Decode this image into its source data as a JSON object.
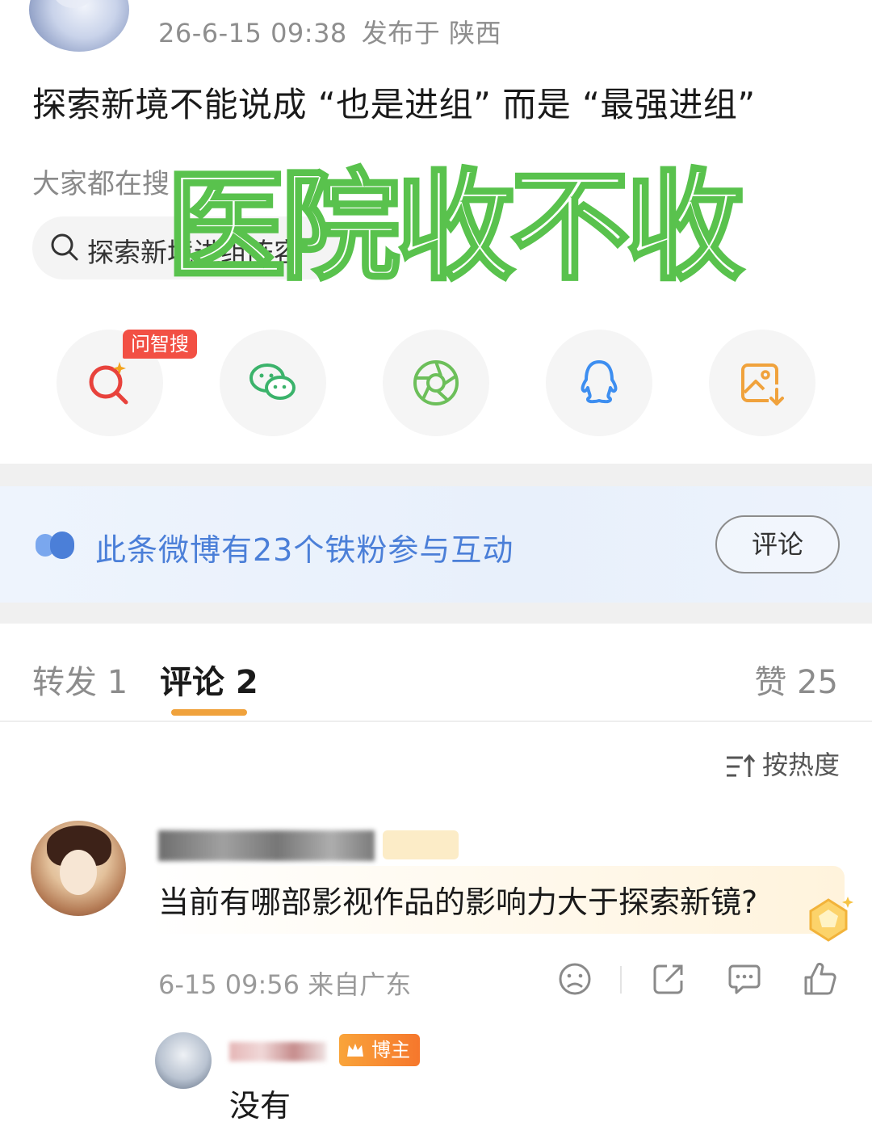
{
  "post": {
    "timestamp": "26-6-15 09:38",
    "location": "发布于 陕西",
    "text": "探索新境不能说成 “也是进组” 而是 “最强进组”"
  },
  "search": {
    "section_title": "大家都在搜",
    "query": "探索新境进组阵容"
  },
  "overlay": {
    "text": "医院收不收"
  },
  "share": {
    "badge": "问智搜",
    "items": [
      "ai-search-icon",
      "wechat-icon",
      "moments-icon",
      "qq-icon",
      "save-image-icon"
    ]
  },
  "fans_banner": {
    "text": "此条微博有23个铁粉参与互动",
    "button": "评论",
    "accent": "#4b7fd8"
  },
  "tabs": {
    "repost": "转发 1",
    "comments": "评论 2",
    "likes": "赞 25",
    "underline_color": "#f0a23c"
  },
  "sort": {
    "label": "按热度"
  },
  "comment": {
    "text": "当前有哪部影视作品的影响力大于探索新镜?",
    "meta": "6-15 09:56 来自广东"
  },
  "reply": {
    "badge": "博主",
    "text": "没有"
  },
  "overlay_color": "#59c24d"
}
